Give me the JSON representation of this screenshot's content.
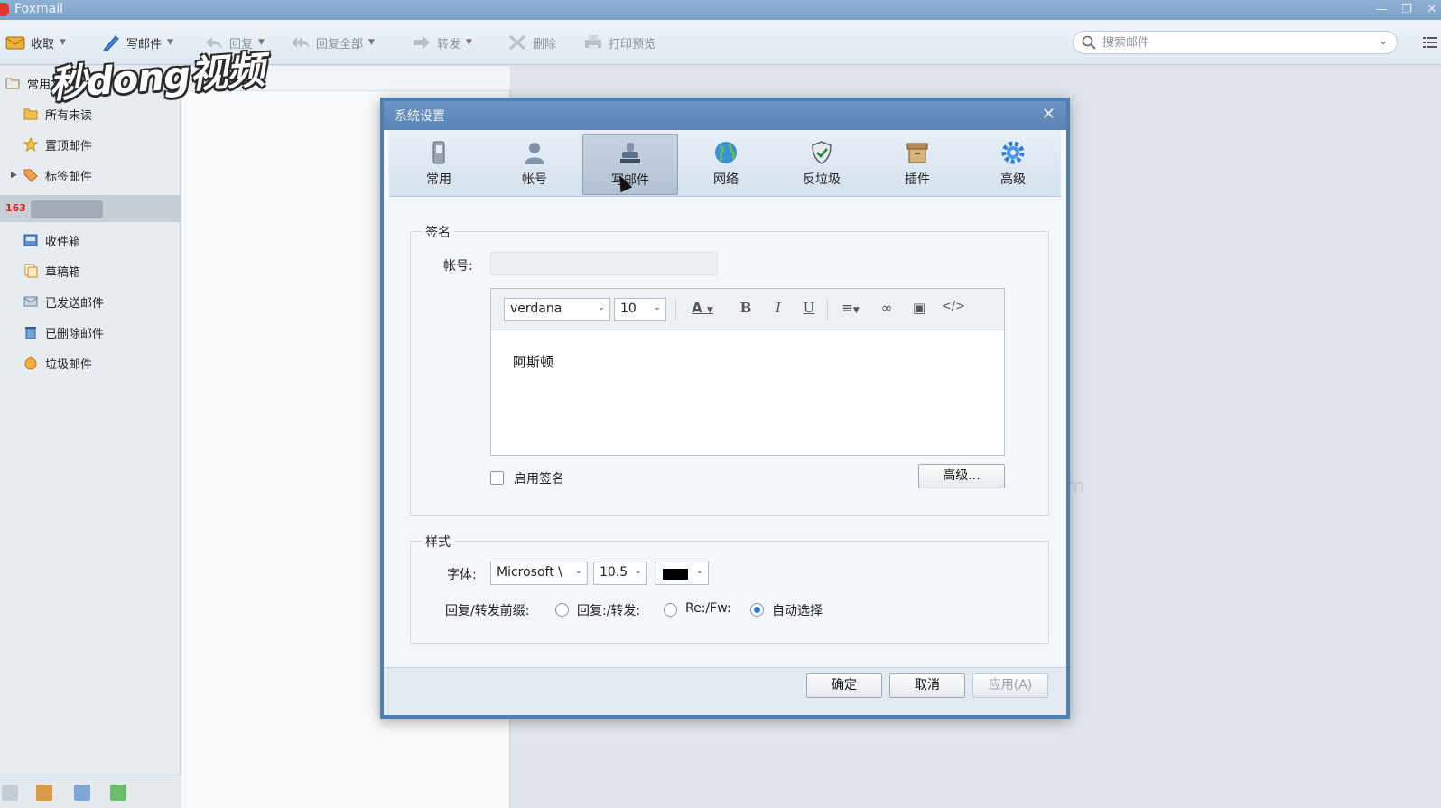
{
  "window": {
    "title": "Foxmail"
  },
  "toolbar": {
    "receive": "收取",
    "compose": "写邮件",
    "reply": "回复",
    "reply_all": "回复全部",
    "forward": "转发",
    "delete": "删除",
    "print_preview": "打印预览"
  },
  "search": {
    "placeholder": "搜索邮件"
  },
  "watermark": {
    "logo_text": "秒dong视频"
  },
  "sidebar": {
    "common_folders": "常用文件夹",
    "items": [
      {
        "label": "所有未读",
        "icon": "folder-icon"
      },
      {
        "label": "置顶邮件",
        "icon": "star-icon"
      },
      {
        "label": "标签邮件",
        "icon": "tag-icon"
      }
    ],
    "account_badge": "163",
    "account_folders": [
      {
        "label": "收件箱",
        "icon": "inbox-icon"
      },
      {
        "label": "草稿箱",
        "icon": "drafts-icon"
      },
      {
        "label": "已发送邮件",
        "icon": "sent-icon"
      },
      {
        "label": "已删除邮件",
        "icon": "trash-icon"
      },
      {
        "label": "垃圾邮件",
        "icon": "junk-icon"
      }
    ]
  },
  "reading_pane": {
    "ghost_text": "m"
  },
  "dialog": {
    "title": "系统设置",
    "tabs": [
      {
        "label": "常用",
        "icon": "phone-icon"
      },
      {
        "label": "帐号",
        "icon": "user-icon"
      },
      {
        "label": "写邮件",
        "icon": "stamp-icon",
        "active": true
      },
      {
        "label": "网络",
        "icon": "globe-icon"
      },
      {
        "label": "反垃圾",
        "icon": "shield-icon"
      },
      {
        "label": "插件",
        "icon": "box-icon"
      },
      {
        "label": "高级",
        "icon": "gear-icon"
      }
    ],
    "signature": {
      "group_title": "签名",
      "account_label": "帐号:",
      "font_family": "verdana",
      "font_size": "10",
      "content": "阿斯顿",
      "enable_label": "启用签名",
      "enable_checked": false,
      "advanced_button": "高级..."
    },
    "style": {
      "group_title": "样式",
      "font_label": "字体:",
      "font_family": "Microsoft \\",
      "font_size": "10.5",
      "font_color": "#000000",
      "prefix_label": "回复/转发前缀:",
      "prefix_options": [
        "回复:/转发:",
        "Re:/Fw:",
        "自动选择"
      ],
      "prefix_selected": 2
    },
    "buttons": {
      "ok": "确定",
      "cancel": "取消",
      "apply": "应用(A)"
    }
  },
  "colors": {
    "accent": "#4f7eb2",
    "title_bar": "#7ea2c8",
    "badge_163": "#d2261b"
  }
}
